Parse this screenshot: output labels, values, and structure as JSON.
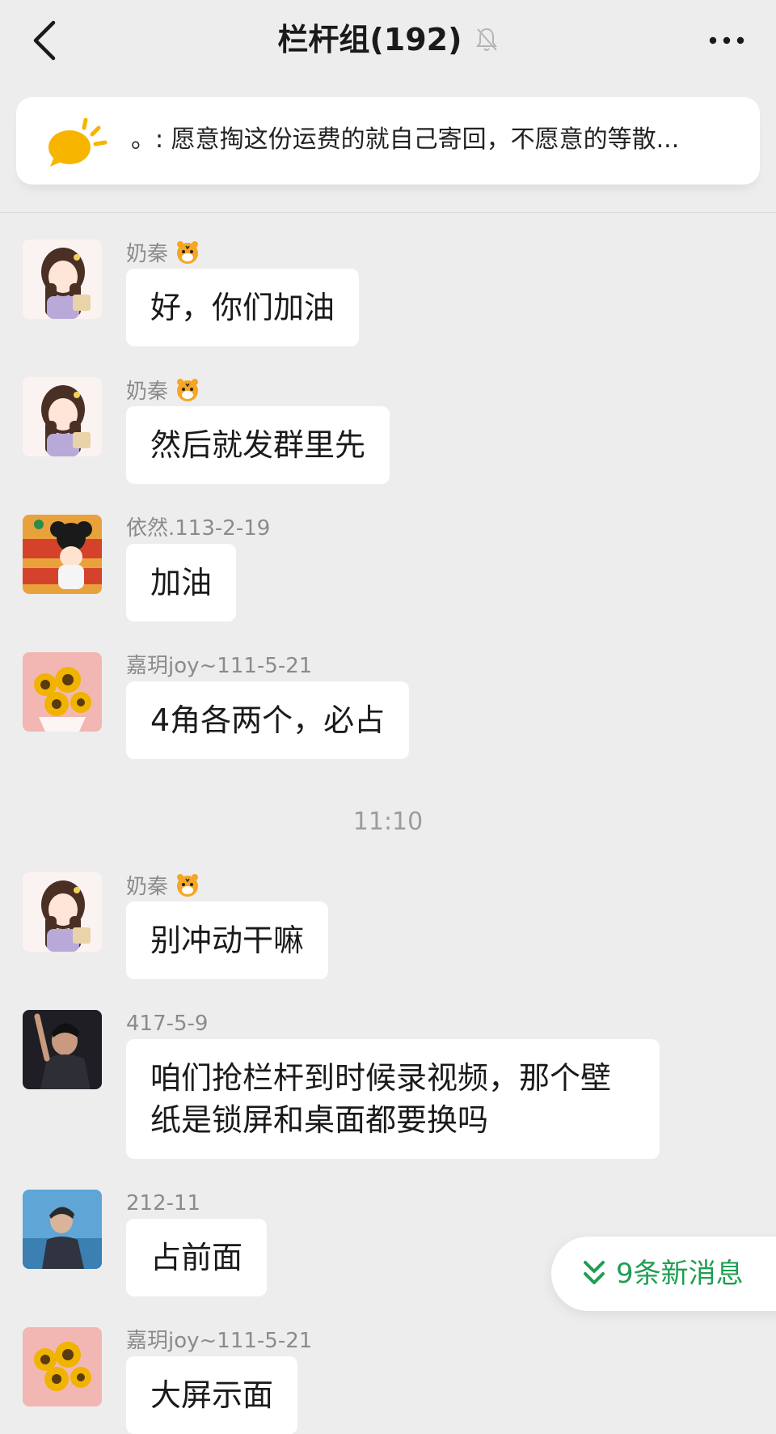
{
  "header": {
    "title": "栏杆组(192)",
    "back_icon": "chevron-left-icon",
    "mute_icon": "bell-muted-icon",
    "more_icon": "more-dots-icon"
  },
  "notice": {
    "icon": "announcement-icon",
    "text": "。: 愿意掏这份运费的就自己寄回，不愿意的等散...",
    "icon_color": "#f7b500"
  },
  "messages": [
    {
      "sender": "奶秦",
      "badge": "tiger-emoji-icon",
      "text": "好，你们加油"
    },
    {
      "sender": "奶秦",
      "badge": "tiger-emoji-icon",
      "text": "然后就发群里先"
    },
    {
      "sender": "依然.113-2-19",
      "text": "加油"
    },
    {
      "sender": "嘉玥joy~111-5-21",
      "text": "4角各两个，必占"
    },
    {
      "sender": "奶秦",
      "badge": "tiger-emoji-icon",
      "text": "别冲动干嘛"
    },
    {
      "sender": "417-5-9",
      "text": "咱们抢栏杆到时候录视频，那个壁纸是锁屏和桌面都要换吗"
    },
    {
      "sender": "212-11",
      "text": "占前面"
    },
    {
      "sender": "嘉玥joy~111-5-21",
      "text": "大屏示面"
    }
  ],
  "timestamp": "11:10",
  "new_messages": {
    "label": "9条新消息",
    "icon": "double-chevron-down-icon",
    "color": "#1f9e52"
  },
  "colors": {
    "background": "#ededed",
    "bubble": "#ffffff",
    "accent_green": "#1f9e52"
  }
}
